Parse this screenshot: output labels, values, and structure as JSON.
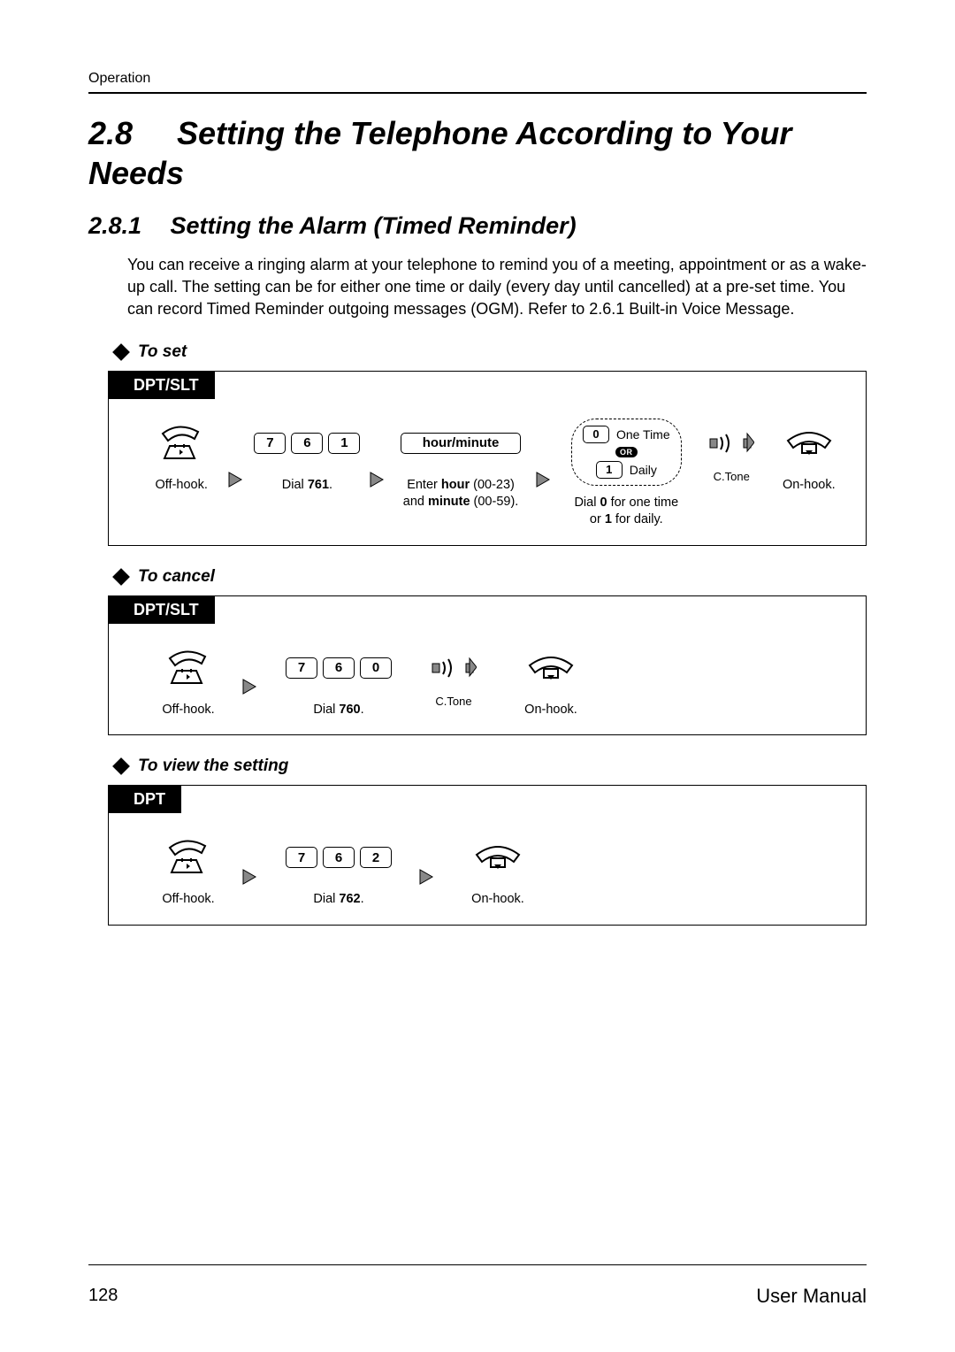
{
  "header": {
    "running": "Operation"
  },
  "section": {
    "number": "2.8",
    "title": "Setting the Telephone According to Your Needs"
  },
  "subsection": {
    "number": "2.8.1",
    "title": "Setting the Alarm (Timed Reminder)",
    "intro": "You can receive a ringing alarm at your telephone to remind you of a meeting, appointment or as a wake-up call. The setting can be for either one time or daily (every day until cancelled) at a pre-set time. You can record Timed Reminder outgoing messages (OGM). Refer to 2.6.1   Built-in Voice Message."
  },
  "procedures": [
    {
      "heading": "To set",
      "device": "DPT/SLT",
      "steps": [
        {
          "caption": "Off-hook."
        },
        {
          "keys": [
            "7",
            "6",
            "1"
          ],
          "caption_pre": "Dial ",
          "caption_bold": "761",
          "caption_post": "."
        },
        {
          "key_label": "hour/minute",
          "cap_l1a": "Enter ",
          "cap_l1b": "hour",
          "cap_l1c": " (00-23)",
          "cap_l2a": "and ",
          "cap_l2b": "minute",
          "cap_l2c": " (00-59)."
        },
        {
          "opt0_key": "0",
          "opt0_label": "One Time",
          "or": "OR",
          "opt1_key": "1",
          "opt1_label": "Daily",
          "cap_l1a": "Dial ",
          "cap_l1b": "0",
          "cap_l1c": " for one time",
          "cap_l2a": "or ",
          "cap_l2b": "1",
          "cap_l2c": " for daily."
        },
        {
          "caption": "C.Tone"
        },
        {
          "caption": "On-hook."
        }
      ]
    },
    {
      "heading": "To cancel",
      "device": "DPT/SLT",
      "steps": [
        {
          "caption": "Off-hook."
        },
        {
          "keys": [
            "7",
            "6",
            "0"
          ],
          "caption_pre": "Dial ",
          "caption_bold": "760",
          "caption_post": "."
        },
        {
          "caption": "C.Tone"
        },
        {
          "caption": "On-hook."
        }
      ]
    },
    {
      "heading": "To view the setting",
      "device": "DPT",
      "steps": [
        {
          "caption": "Off-hook."
        },
        {
          "keys": [
            "7",
            "6",
            "2"
          ],
          "caption_pre": "Dial ",
          "caption_bold": "762",
          "caption_post": "."
        },
        {
          "caption": "On-hook."
        }
      ]
    }
  ],
  "footer": {
    "page": "128",
    "manual": "User Manual"
  }
}
